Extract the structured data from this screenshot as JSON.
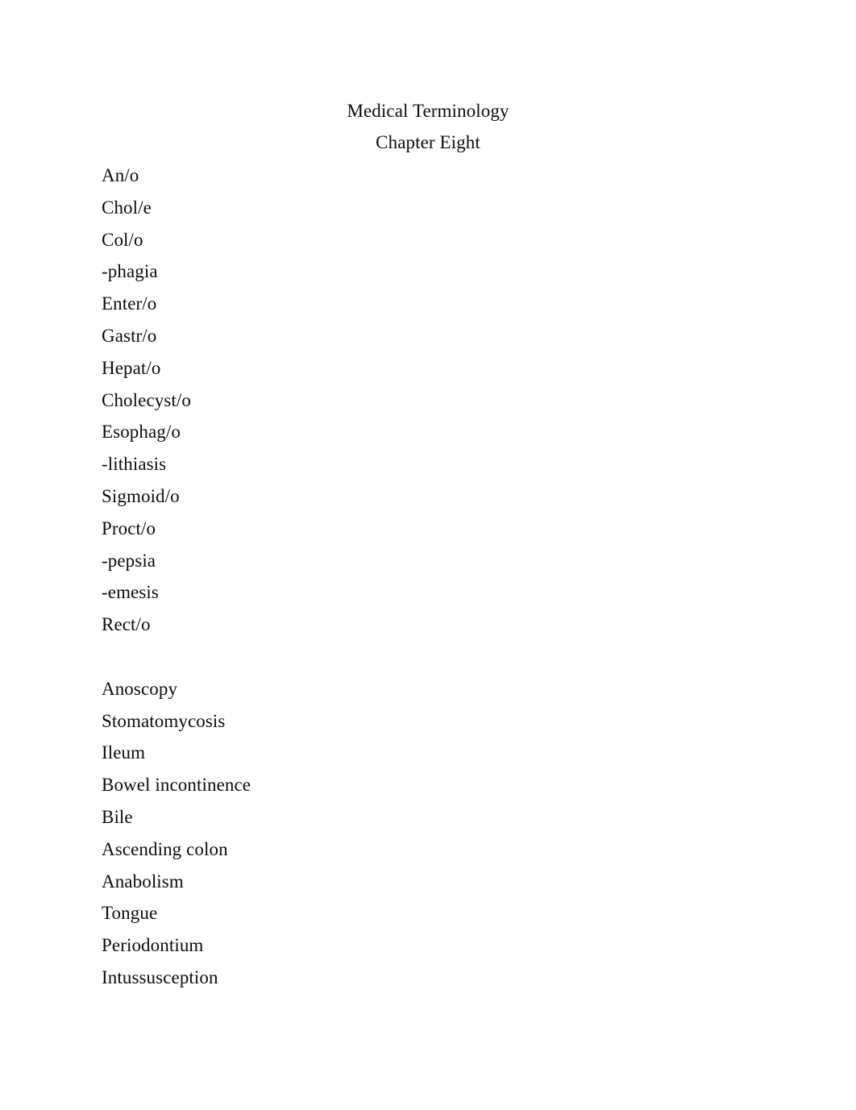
{
  "document": {
    "title": "Medical Terminology",
    "subtitle": "Chapter Eight",
    "text_color": "#0d0d0d",
    "background_color": "#ffffff"
  },
  "word_parts_list": {
    "items": [
      "An/o",
      "Chol/e",
      "Col/o",
      "-phagia",
      "Enter/o",
      "Gastr/o",
      "Hepat/o",
      "Cholecyst/o",
      "Esophag/o",
      "-lithiasis",
      "Sigmoid/o",
      "Proct/o",
      "-pepsia",
      "-emesis",
      "Rect/o"
    ]
  },
  "terms_list": {
    "items": [
      "Anoscopy",
      "Stomatomycosis",
      "Ileum",
      "Bowel incontinence",
      "Bile",
      "Ascending colon",
      "Anabolism",
      "Tongue",
      "Periodontium",
      "Intussusception"
    ]
  }
}
